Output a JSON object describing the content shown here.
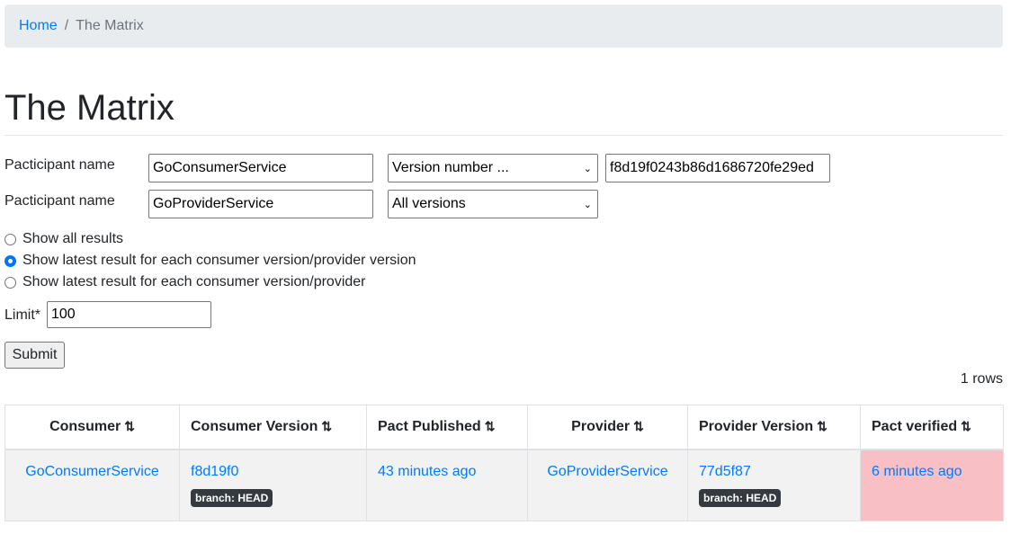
{
  "breadcrumb": {
    "home": "Home",
    "separator": "/",
    "current": "The Matrix"
  },
  "page_title": "The Matrix",
  "form": {
    "row1": {
      "label": "Pacticipant name",
      "name": "GoConsumerService",
      "select": "Version number ...",
      "version": "f8d19f0243b86d1686720fe29ed"
    },
    "row2": {
      "label": "Pacticipant name",
      "name": "GoProviderService",
      "select": "All versions"
    },
    "radios": [
      {
        "label": "Show all results",
        "checked": false
      },
      {
        "label": "Show latest result for each consumer version/provider version",
        "checked": true
      },
      {
        "label": "Show latest result for each consumer version/provider",
        "checked": false
      }
    ],
    "limit_label": "Limit*",
    "limit": "100",
    "submit": "Submit"
  },
  "rows_count": "1 rows",
  "table": {
    "headers": [
      "Consumer",
      "Consumer Version",
      "Pact Published",
      "Provider",
      "Provider Version",
      "Pact verified"
    ],
    "sort_icon": "⇅",
    "row": {
      "consumer": "GoConsumerService",
      "consumer_version": "f8d19f0",
      "consumer_branch": "branch: HEAD",
      "published": "43 minutes ago",
      "provider": "GoProviderService",
      "provider_version": "77d5f87",
      "provider_branch": "branch: HEAD",
      "verified": "6 minutes ago"
    },
    "verified_status_color": "#f8bfc4"
  }
}
